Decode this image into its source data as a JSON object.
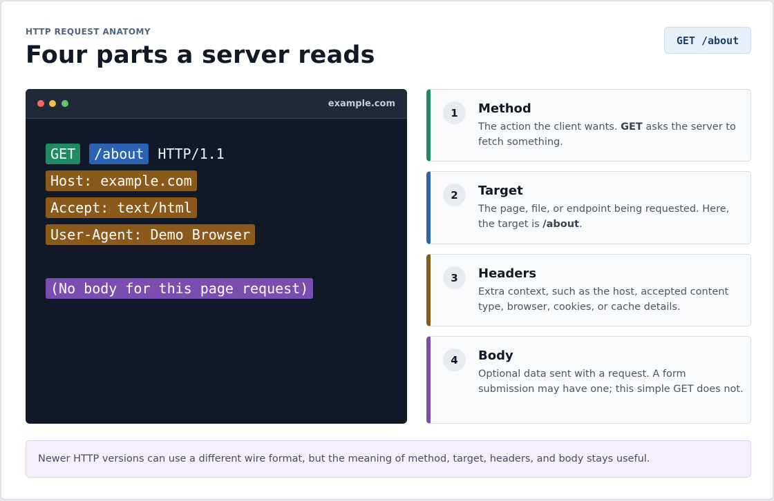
{
  "header": {
    "eyebrow": "HTTP REQUEST ANATOMY",
    "title": "Four parts a server reads",
    "badge": "GET /about"
  },
  "terminal": {
    "host": "example.com",
    "request_line": {
      "method": "GET",
      "target": "/about",
      "version": "HTTP/1.1"
    },
    "headers": [
      "Host: example.com",
      "Accept: text/html",
      "User-Agent: Demo Browser"
    ],
    "body": "(No body for this page request)"
  },
  "cards": [
    {
      "number": "1",
      "title": "Method",
      "text_before": "The action the client wants. ",
      "text_bold": "GET",
      "text_after": " asks the server to fetch something."
    },
    {
      "number": "2",
      "title": "Target",
      "text_before": "The page, file, or endpoint being requested. Here, the target is ",
      "text_bold": "/about",
      "text_after": "."
    },
    {
      "number": "3",
      "title": "Headers",
      "text": "Extra context, such as the host, accepted content type, browser, cookies, or cache details."
    },
    {
      "number": "4",
      "title": "Body",
      "text": "Optional data sent with a request. A form submission may have one; this simple GET does not."
    }
  ],
  "note": "Newer HTTP versions can use a different wire format, but the meaning of method, target, headers, and body stays useful.",
  "colors": {
    "method": "#1f8a63",
    "target": "#2c62b3",
    "headers": "#8b5a1b",
    "body": "#7c4db0"
  }
}
